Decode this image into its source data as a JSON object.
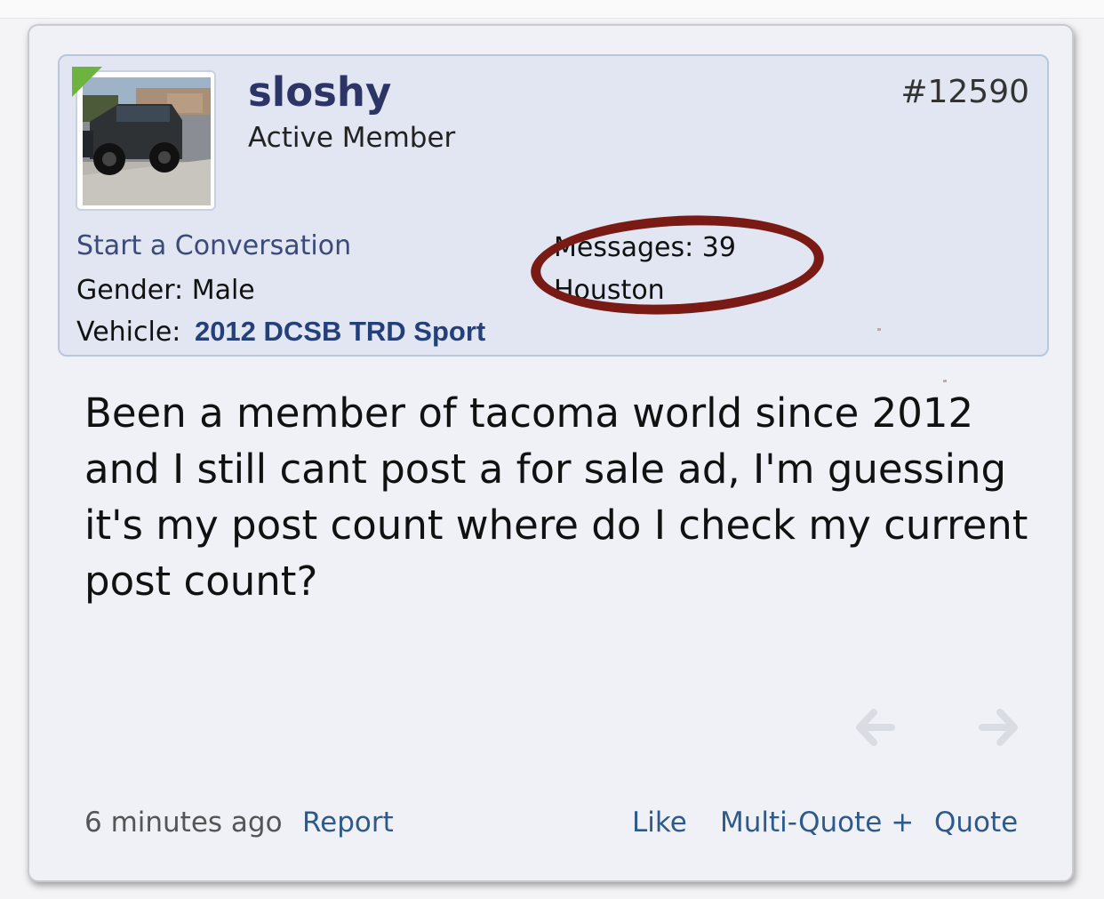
{
  "post": {
    "number": "#12590",
    "body": "Been a member of tacoma world since 2012 and I still cant post a for sale ad, I'm guessing it's my post count where do I check my current post count?",
    "timestamp": "6 minutes ago"
  },
  "user": {
    "name": "sloshy",
    "title": "Active Member",
    "online": true,
    "start_conversation_label": "Start a Conversation",
    "gender_label": "Gender:",
    "gender_value": "Male",
    "vehicle_label": "Vehicle:",
    "vehicle_value": "2012 DCSB TRD Sport",
    "messages_label": "Messages:",
    "messages_value": "39",
    "location": "Houston"
  },
  "actions": {
    "report": "Report",
    "like": "Like",
    "multi_quote": "Multi-Quote +",
    "quote": "Quote"
  },
  "icons": {
    "prev": "arrow-left-icon",
    "next": "arrow-right-icon"
  },
  "colors": {
    "username": "#2c3565",
    "link": "#2d5a8e",
    "annotation_circle": "#7a1a14",
    "online_badge": "#6db33f",
    "user_box_bg": "#e2e5f2"
  }
}
